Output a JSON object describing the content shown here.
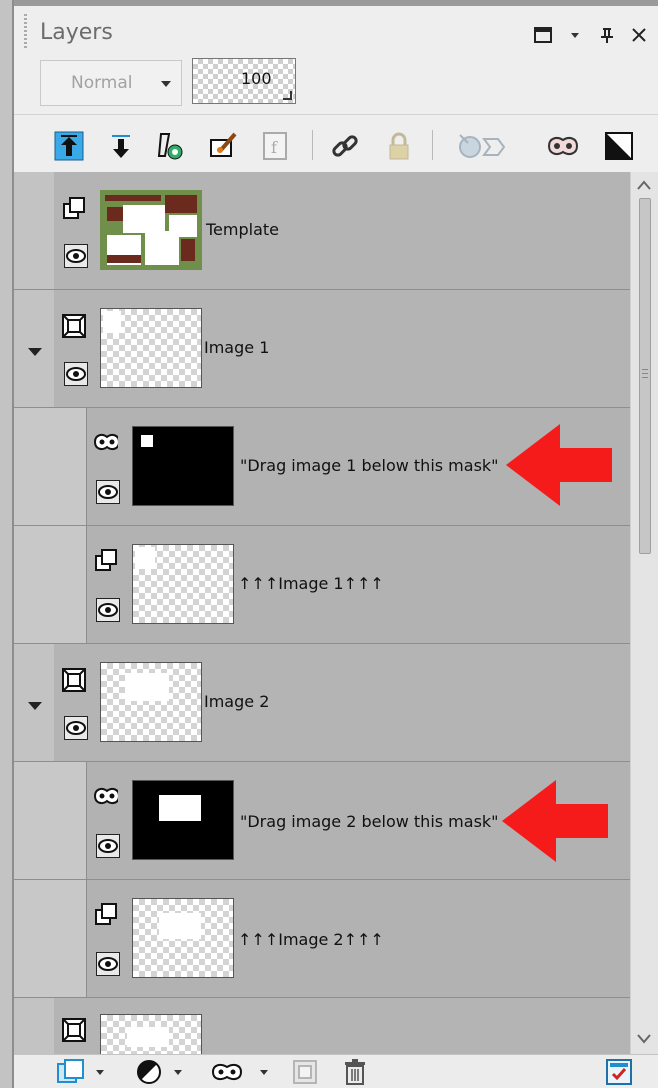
{
  "panel": {
    "title": "Layers",
    "icons": [
      "restore-icon",
      "dropdown-icon",
      "pin-icon",
      "close-icon"
    ]
  },
  "blend": {
    "mode": "Normal",
    "opacity": "100"
  },
  "toolbar": {
    "icons": [
      "move-layer-up-icon",
      "move-layer-down-icon",
      "layer-styles-icon",
      "edit-selection-icon",
      "new-mask-from-image-icon",
      "link-layers-icon",
      "lock-layer-icon",
      "mask-visibility-icon",
      "new-mask-icon",
      "invert-mask-icon"
    ]
  },
  "layers": [
    {
      "name": "Template",
      "type": "raster",
      "expandable": false
    },
    {
      "name": "Image 1",
      "type": "group",
      "expandable": true
    },
    {
      "name": "\"Drag image 1 below this mask\"",
      "type": "mask",
      "annotated": true
    },
    {
      "name": "↑↑↑Image 1↑↑↑",
      "type": "raster"
    },
    {
      "name": "Image 2",
      "type": "group",
      "expandable": true
    },
    {
      "name": "\"Drag image 2 below this mask\"",
      "type": "mask",
      "annotated": true
    },
    {
      "name": "↑↑↑Image 2↑↑↑",
      "type": "raster"
    },
    {
      "name": "",
      "type": "group"
    }
  ],
  "colors": {
    "annotation_arrow": "#f51b1b",
    "accent": "#1f8fd0"
  },
  "bottom_toolbar": {
    "icons": [
      "new-raster-layer-icon",
      "new-adjustment-layer-icon",
      "new-mask-layer-icon",
      "new-group-icon",
      "delete-layer-icon",
      "layer-properties-icon"
    ]
  }
}
